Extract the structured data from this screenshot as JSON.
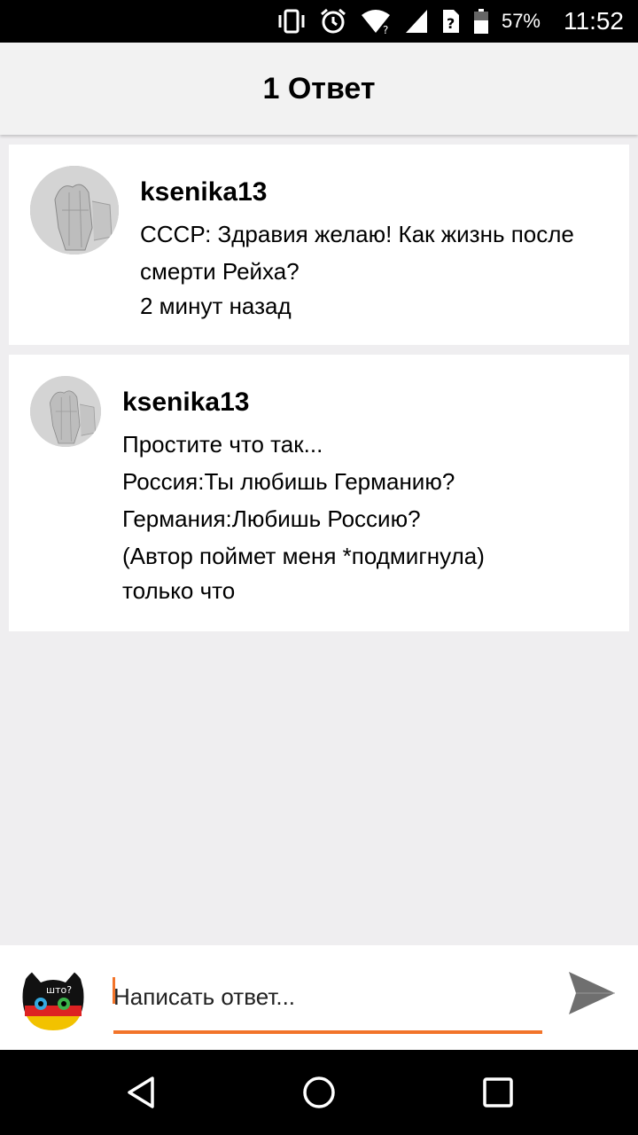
{
  "status_bar": {
    "battery_percent": "57%",
    "time": "11:52",
    "icons": [
      "vibrate-icon",
      "alarm-icon",
      "wifi-icon",
      "signal-icon",
      "unknown-sim-icon",
      "battery-icon"
    ]
  },
  "header": {
    "title": "1 Ответ"
  },
  "comments": [
    {
      "username": "ksenika13",
      "text": "СССР: Здравия желаю! Как жизнь после\nсмерти Рейха?",
      "time": "2 минут назад"
    },
    {
      "username": "ksenika13",
      "text": "Простите что так...\nРоссия:Ты любишь Германию?\nГермания:Любишь Россию?\n(Автор поймет меня *подмигнула)",
      "time": "только что"
    }
  ],
  "composer": {
    "placeholder": "Написать ответ...",
    "value": "",
    "accent_color": "#f2742a",
    "avatar_text": "што?"
  },
  "nav": {
    "buttons": [
      "back-icon",
      "home-icon",
      "recents-icon"
    ]
  }
}
